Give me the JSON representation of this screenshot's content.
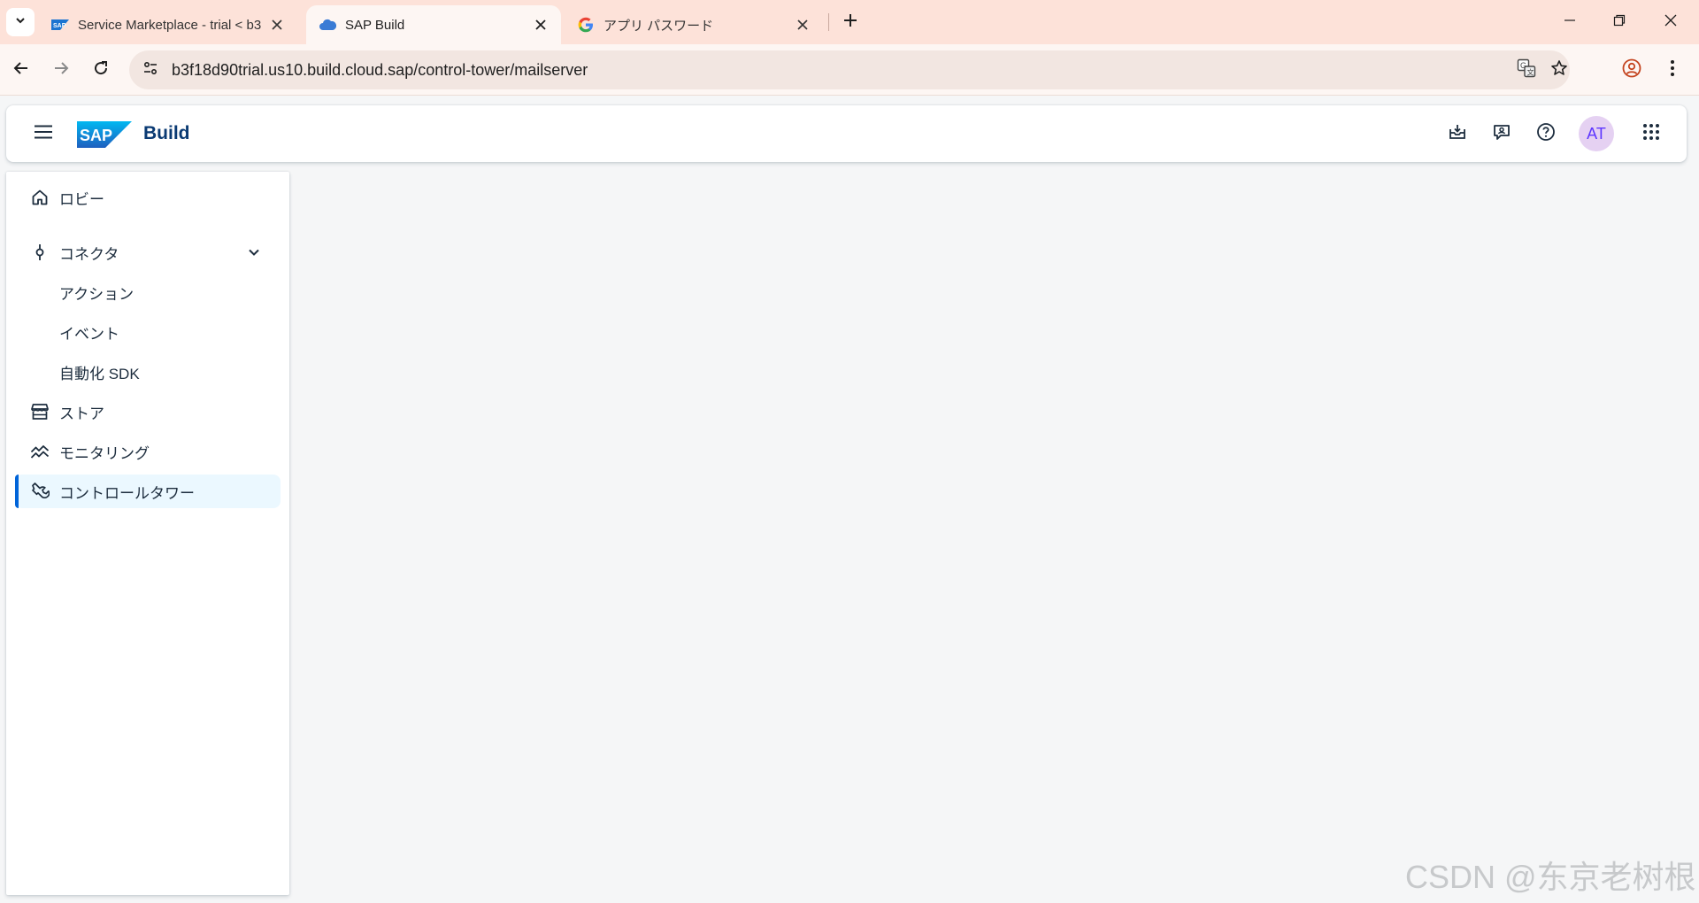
{
  "browser": {
    "tabs": [
      {
        "title": "Service Marketplace - trial < b3",
        "favicon": "sap-icon",
        "active": false
      },
      {
        "title": "SAP Build",
        "favicon": "cloud-icon",
        "active": true
      },
      {
        "title": "アプリ パスワード",
        "favicon": "google-icon",
        "active": false
      }
    ],
    "url": "b3f18d90trial.us10.build.cloud.sap/control-tower/mailserver"
  },
  "shell": {
    "logo_text": "SAP",
    "product": "Build",
    "avatar_initials": "AT",
    "actions": [
      "inbox-icon",
      "feedback-icon",
      "help-icon",
      "product-switch-icon"
    ]
  },
  "sidebar": {
    "items": [
      {
        "label": "ロビー",
        "icon": "home-icon"
      },
      {
        "label": "コネクタ",
        "icon": "connector-icon",
        "expanded": true
      },
      {
        "label": "アクション",
        "sub": true
      },
      {
        "label": "イベント",
        "sub": true
      },
      {
        "label": "自動化 SDK",
        "sub": true
      },
      {
        "label": "ストア",
        "icon": "store-icon"
      },
      {
        "label": "モニタリング",
        "icon": "monitoring-icon"
      },
      {
        "label": "コントロールタワー",
        "icon": "wrench-icon",
        "selected": true
      }
    ]
  },
  "watermark": "CSDN @东京老树根",
  "colors": {
    "tabstrip": "#fde2d9",
    "accent": "#0064d9",
    "selected_bg": "#ebf8ff",
    "brand_text": "#0a3a73"
  }
}
